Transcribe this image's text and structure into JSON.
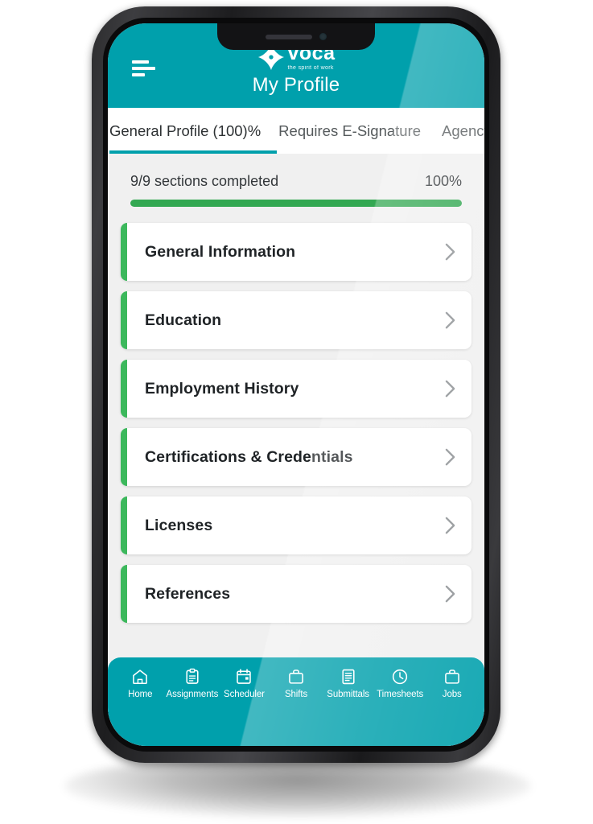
{
  "header": {
    "menu_icon": "hamburger-menu-icon",
    "brand_name": "voca",
    "brand_tagline": "the spirit of work",
    "brand_mark_icon": "four-point-star-icon",
    "page_title": "My Profile",
    "background_color": "#00A0AC"
  },
  "tabs": {
    "items": [
      {
        "label": "General Profile (100)%",
        "active": true
      },
      {
        "label": "Requires E-Signature",
        "active": false
      },
      {
        "label": "Agency Do",
        "active": false
      }
    ],
    "active_underline_color": "#00A0AC"
  },
  "progress": {
    "sections_label": "9/9 sections completed",
    "percent_label": "100%",
    "percent_value": 100,
    "bar_color": "#33A852",
    "track_color": "#D8DCD9"
  },
  "sections": {
    "accent_color": "#3CB85C",
    "chevron_icon": "chevron-right-icon",
    "items": [
      {
        "title": "General Information"
      },
      {
        "title": "Education"
      },
      {
        "title": "Employment History"
      },
      {
        "title": "Certifications & Credentials"
      },
      {
        "title": "Licenses"
      },
      {
        "title": "References"
      }
    ]
  },
  "bottom_nav": {
    "background_color": "#00A0AC",
    "items": [
      {
        "label": "Home",
        "icon": "home-icon"
      },
      {
        "label": "Assignments",
        "icon": "clipboard-icon"
      },
      {
        "label": "Scheduler",
        "icon": "calendar-icon"
      },
      {
        "label": "Shifts",
        "icon": "briefcase-icon"
      },
      {
        "label": "Submittals",
        "icon": "document-icon"
      },
      {
        "label": "Timesheets",
        "icon": "clock-icon"
      },
      {
        "label": "Jobs",
        "icon": "briefcase-icon"
      }
    ]
  }
}
